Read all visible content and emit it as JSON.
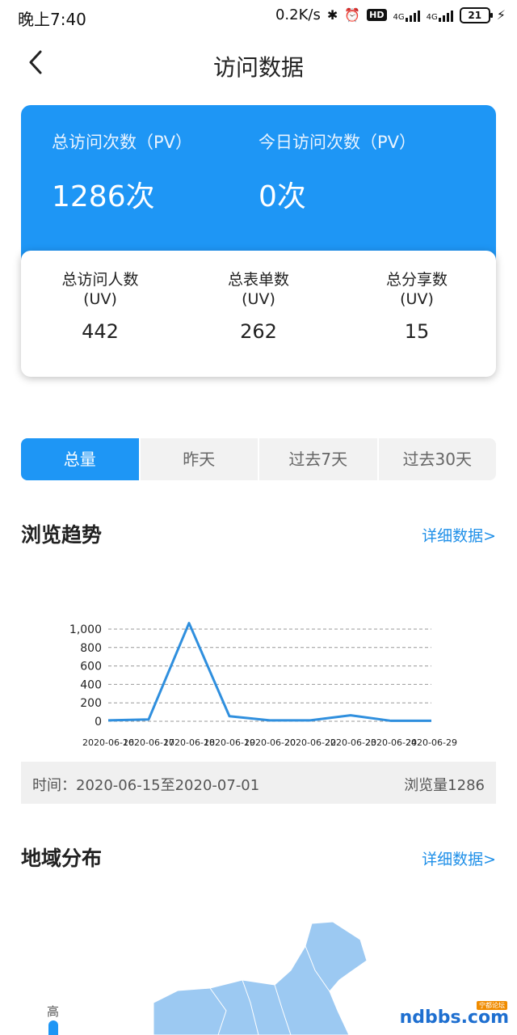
{
  "status_bar": {
    "time": "晚上7:40",
    "speed": "0.2K/s",
    "hd": "HD",
    "net1": "4G",
    "net2": "4G",
    "battery": "21"
  },
  "nav": {
    "title": "访问数据"
  },
  "summary": {
    "total_pv_label": "总访问次数（PV）",
    "total_pv_value": "1286次",
    "today_pv_label": "今日访问次数（PV）",
    "today_pv_value": "0次"
  },
  "stats": [
    {
      "label": "总访问人数",
      "sub": "(UV)",
      "value": "442"
    },
    {
      "label": "总表单数",
      "sub": "(UV)",
      "value": "262"
    },
    {
      "label": "总分享数",
      "sub": "(UV)",
      "value": "15"
    }
  ],
  "tabs": [
    {
      "label": "总量",
      "active": true
    },
    {
      "label": "昨天",
      "active": false
    },
    {
      "label": "过去7天",
      "active": false
    },
    {
      "label": "过去30天",
      "active": false
    }
  ],
  "trend": {
    "title": "浏览趋势",
    "detail_link": "详细数据>",
    "info_time": "时间：2020-06-15至2020-07-01",
    "info_total": "浏览量1286"
  },
  "chart_data": {
    "type": "line",
    "x": [
      "2020-06-16",
      "2020-06-17",
      "2020-06-18",
      "2020-06-19",
      "2020-06-20",
      "2020-06-22",
      "2020-06-23",
      "2020-06-24",
      "2020-06-29"
    ],
    "values": [
      10,
      20,
      1065,
      55,
      10,
      10,
      65,
      5,
      5
    ],
    "ylim": [
      0,
      1000
    ],
    "yticks": [
      "0",
      "200",
      "400",
      "600",
      "800",
      "1,000"
    ],
    "grid": true,
    "line_color": "#2f8fde"
  },
  "region": {
    "title": "地域分布",
    "detail_link": "详细数据>",
    "legend_high": "高"
  },
  "watermark": {
    "logo": "ndbbs.com",
    "badge": "宁都论坛"
  },
  "colors": {
    "accent": "#1e96f5",
    "link": "#1e8fe8"
  }
}
